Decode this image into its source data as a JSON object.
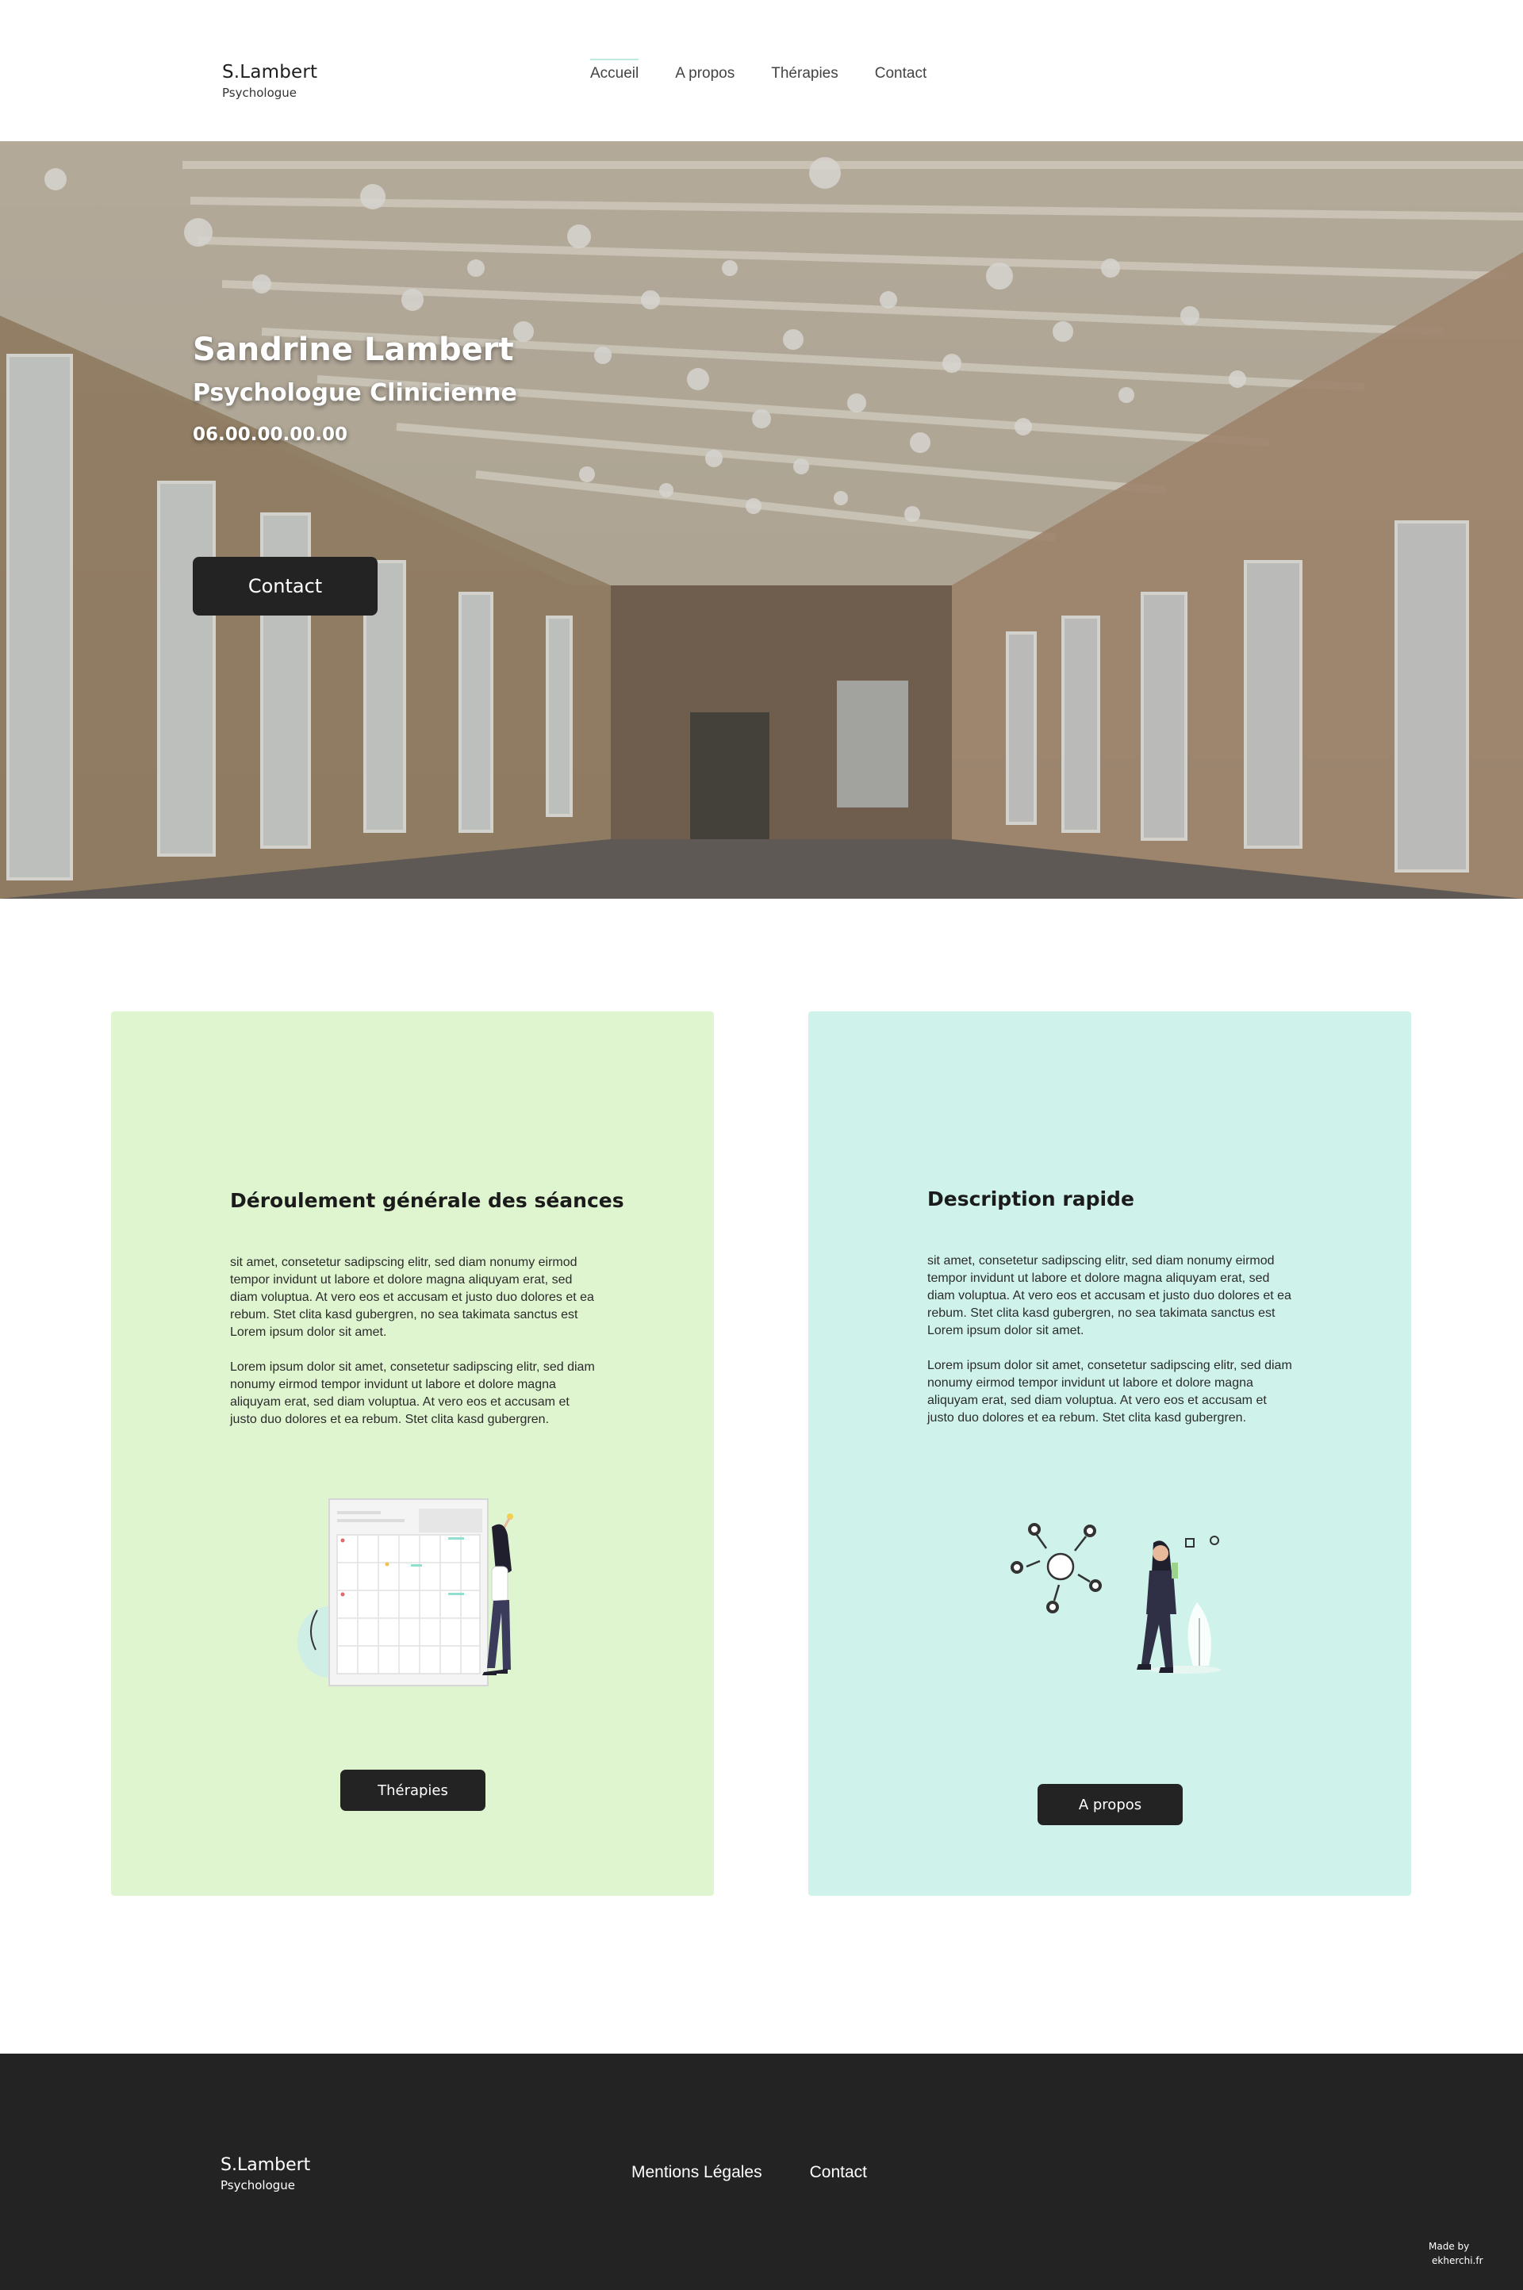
{
  "header": {
    "brand_name": "S.Lambert",
    "brand_sub": "Psychologue",
    "nav": [
      {
        "label": "Accueil",
        "active": true
      },
      {
        "label": "A propos",
        "active": false
      },
      {
        "label": "Thérapies",
        "active": false
      },
      {
        "label": "Contact",
        "active": false
      }
    ]
  },
  "hero": {
    "name": "Sandrine Lambert",
    "role": "Psychologue Clinicienne",
    "phone": "06.00.00.00.00",
    "button_label": "Contact"
  },
  "cards": [
    {
      "title": "Déroulement générale des séances",
      "paragraphs": [
        "sit amet, consetetur sadipscing elitr, sed diam nonumy eirmod tempor invidunt ut labore et dolore magna aliquyam erat, sed diam voluptua. At vero eos et accusam et justo duo dolores et ea rebum. Stet clita kasd gubergren, no sea takimata sanctus est Lorem ipsum dolor sit amet.",
        "Lorem ipsum dolor sit amet, consetetur sadipscing elitr, sed diam nonumy eirmod tempor invidunt ut labore et dolore magna aliquyam erat, sed diam voluptua. At vero eos et accusam et justo duo dolores et ea rebum. Stet clita kasd gubergren."
      ],
      "illustration": "calendar-woman-illustration",
      "button_label": "Thérapies",
      "color": "#dff5cf"
    },
    {
      "title": "Description rapide",
      "paragraphs": [
        "sit amet, consetetur sadipscing elitr, sed diam nonumy eirmod tempor invidunt ut labore et dolore magna aliquyam erat, sed diam voluptua. At vero eos et accusam et justo duo dolores et ea rebum. Stet clita kasd gubergren, no sea takimata sanctus est Lorem ipsum dolor sit amet.",
        "Lorem ipsum dolor sit amet, consetetur sadipscing elitr, sed diam nonumy eirmod tempor invidunt ut labore et dolore magna aliquyam erat, sed diam voluptua. At vero eos et accusam et justo duo dolores et ea rebum. Stet clita kasd gubergren."
      ],
      "illustration": "network-woman-illustration",
      "button_label": "A propos",
      "color": "#cff3ea"
    }
  ],
  "footer": {
    "brand_name": "S.Lambert",
    "brand_sub": "Psychologue",
    "links": [
      "Mentions Légales",
      "Contact"
    ],
    "made_by": "Made by",
    "made_by_site": "ekherchi.fr",
    "background": "#232323"
  },
  "colors": {
    "button": "#232323",
    "nav_active_underline": "#bfe9e1"
  }
}
